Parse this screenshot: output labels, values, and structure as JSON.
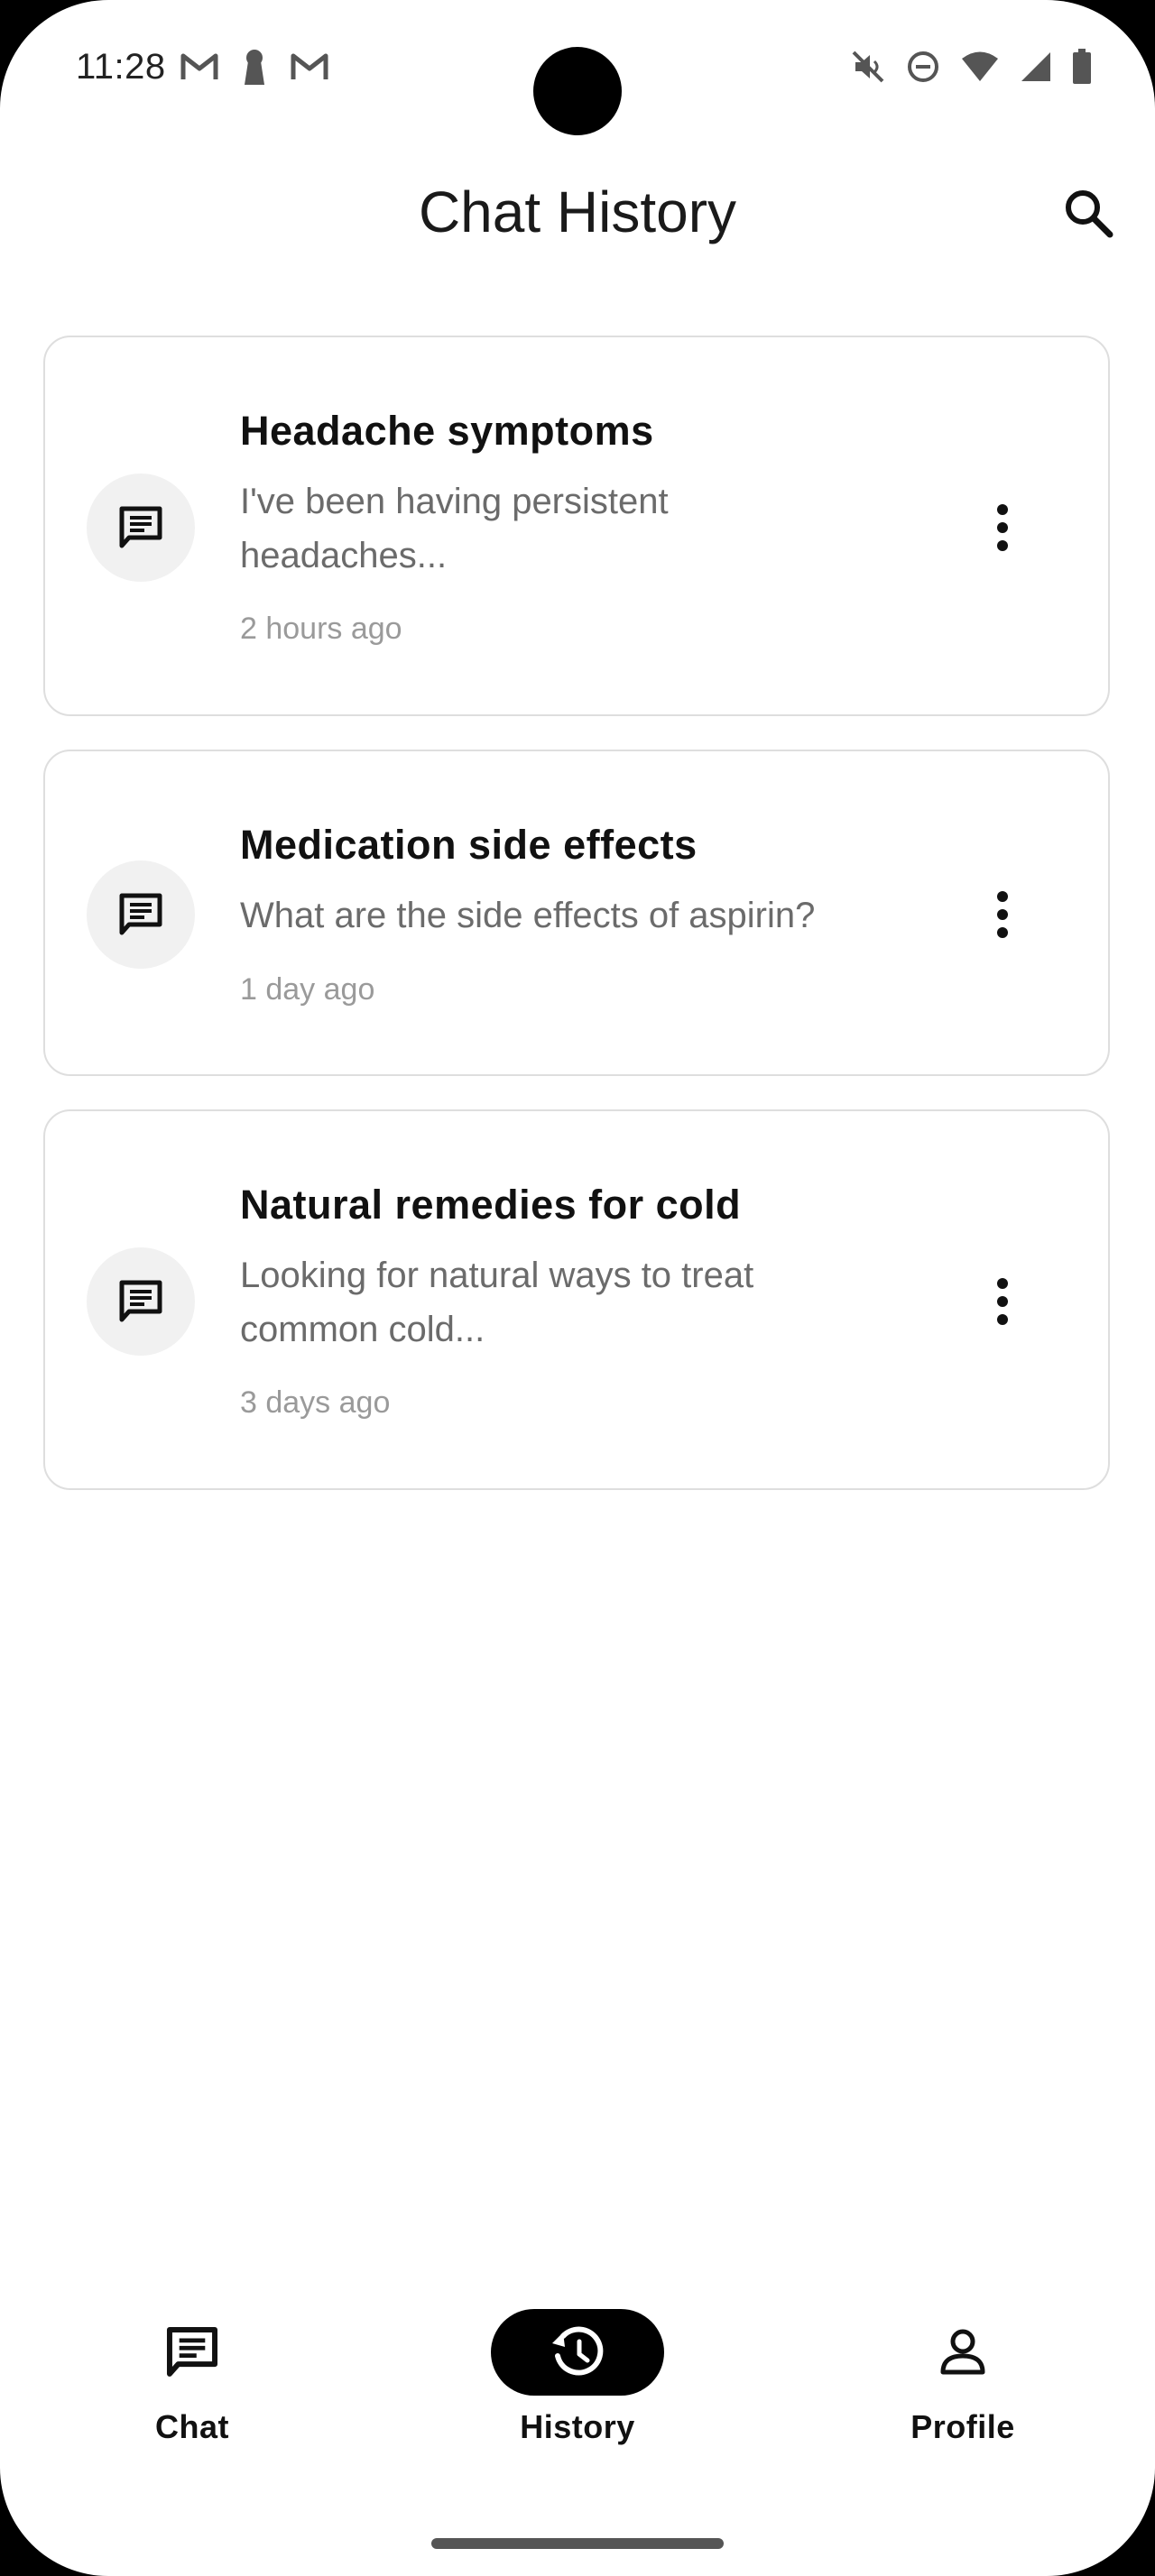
{
  "status_bar": {
    "time": "11:28",
    "left_icons": [
      "gmail-icon",
      "keyhole-icon",
      "gmail-icon"
    ],
    "right_icons": [
      "mute-icon",
      "do-not-disturb-icon",
      "wifi-icon",
      "signal-icon",
      "battery-icon"
    ]
  },
  "app_bar": {
    "title": "Chat History",
    "search_icon": "search-icon"
  },
  "chats": [
    {
      "title": "Headache symptoms",
      "preview": "I've been having persistent headaches...",
      "time": "2 hours ago"
    },
    {
      "title": "Medication side effects",
      "preview": "What are the side effects of aspirin?",
      "time": "1 day ago"
    },
    {
      "title": "Natural remedies for cold",
      "preview": "Looking for natural ways to treat common cold...",
      "time": "3 days ago"
    }
  ],
  "bottom_nav": {
    "items": [
      {
        "label": "Chat",
        "icon": "chat-icon",
        "active": false
      },
      {
        "label": "History",
        "icon": "history-icon",
        "active": true
      },
      {
        "label": "Profile",
        "icon": "person-icon",
        "active": false
      }
    ]
  },
  "colors": {
    "card_border": "#dedede",
    "icon_circle_bg": "#f1f1f1",
    "active_nav_bg": "#000000",
    "preview_text": "#6b6b6b",
    "timestamp_text": "#9a9a9a"
  }
}
